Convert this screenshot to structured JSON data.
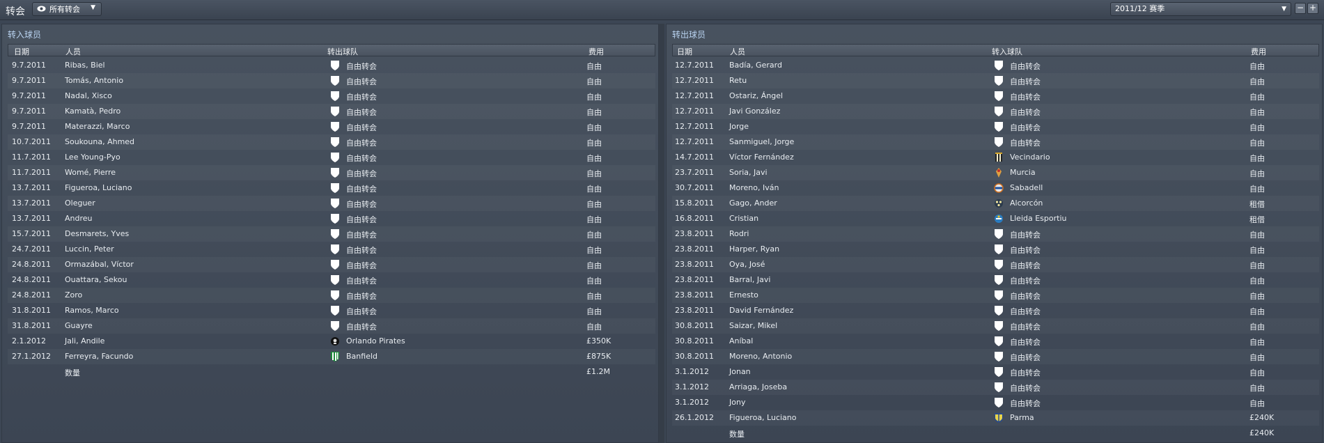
{
  "header": {
    "title": "转会",
    "view_label": "所有转会",
    "season_label": "2011/12 赛季"
  },
  "incoming": {
    "title": "转入球员",
    "columns": [
      "日期",
      "人员",
      "转出球队",
      "费用"
    ],
    "rows": [
      {
        "date": "9.7.2011",
        "person": "Ribas, Biel",
        "club": "自由转会",
        "fee": "自由",
        "crest": "shield"
      },
      {
        "date": "9.7.2011",
        "person": "Tomás, Antonio",
        "club": "自由转会",
        "fee": "自由",
        "crest": "shield"
      },
      {
        "date": "9.7.2011",
        "person": "Nadal, Xisco",
        "club": "自由转会",
        "fee": "自由",
        "crest": "shield"
      },
      {
        "date": "9.7.2011",
        "person": "Kamatà, Pedro",
        "club": "自由转会",
        "fee": "自由",
        "crest": "shield"
      },
      {
        "date": "9.7.2011",
        "person": "Materazzi, Marco",
        "club": "自由转会",
        "fee": "自由",
        "crest": "shield"
      },
      {
        "date": "10.7.2011",
        "person": "Soukouna, Ahmed",
        "club": "自由转会",
        "fee": "自由",
        "crest": "shield"
      },
      {
        "date": "11.7.2011",
        "person": "Lee Young-Pyo",
        "club": "自由转会",
        "fee": "自由",
        "crest": "shield"
      },
      {
        "date": "11.7.2011",
        "person": "Womé, Pierre",
        "club": "自由转会",
        "fee": "自由",
        "crest": "shield"
      },
      {
        "date": "13.7.2011",
        "person": "Figueroa, Luciano",
        "club": "自由转会",
        "fee": "自由",
        "crest": "shield"
      },
      {
        "date": "13.7.2011",
        "person": "Oleguer",
        "club": "自由转会",
        "fee": "自由",
        "crest": "shield"
      },
      {
        "date": "13.7.2011",
        "person": "Andreu",
        "club": "自由转会",
        "fee": "自由",
        "crest": "shield"
      },
      {
        "date": "15.7.2011",
        "person": "Desmarets, Yves",
        "club": "自由转会",
        "fee": "自由",
        "crest": "shield"
      },
      {
        "date": "24.7.2011",
        "person": "Luccin, Peter",
        "club": "自由转会",
        "fee": "自由",
        "crest": "shield"
      },
      {
        "date": "24.8.2011",
        "person": "Ormazábal, Víctor",
        "club": "自由转会",
        "fee": "自由",
        "crest": "shield"
      },
      {
        "date": "24.8.2011",
        "person": "Ouattara, Sekou",
        "club": "自由转会",
        "fee": "自由",
        "crest": "shield"
      },
      {
        "date": "24.8.2011",
        "person": "Zoro",
        "club": "自由转会",
        "fee": "自由",
        "crest": "shield"
      },
      {
        "date": "31.8.2011",
        "person": "Ramos, Marco",
        "club": "自由转会",
        "fee": "自由",
        "crest": "shield"
      },
      {
        "date": "31.8.2011",
        "person": "Guayre",
        "club": "自由转会",
        "fee": "自由",
        "crest": "shield"
      },
      {
        "date": "2.1.2012",
        "person": "Jali, Andile",
        "club": "Orlando Pirates",
        "fee": "£350K",
        "crest": "pirates"
      },
      {
        "date": "27.1.2012",
        "person": "Ferreyra, Facundo",
        "club": "Banfield",
        "fee": "£875K",
        "crest": "banfield"
      }
    ],
    "total_label": "数量",
    "total_fee": "£1.2M"
  },
  "outgoing": {
    "title": "转出球员",
    "columns": [
      "日期",
      "人员",
      "转入球队",
      "费用"
    ],
    "rows": [
      {
        "date": "12.7.2011",
        "person": "Badía, Gerard",
        "club": "自由转会",
        "fee": "自由",
        "crest": "shield"
      },
      {
        "date": "12.7.2011",
        "person": "Retu",
        "club": "自由转会",
        "fee": "自由",
        "crest": "shield"
      },
      {
        "date": "12.7.2011",
        "person": "Ostariz, Ángel",
        "club": "自由转会",
        "fee": "自由",
        "crest": "shield"
      },
      {
        "date": "12.7.2011",
        "person": "Javi González",
        "club": "自由转会",
        "fee": "自由",
        "crest": "shield"
      },
      {
        "date": "12.7.2011",
        "person": "Jorge",
        "club": "自由转会",
        "fee": "自由",
        "crest": "shield"
      },
      {
        "date": "12.7.2011",
        "person": "Sanmiguel, Jorge",
        "club": "自由转会",
        "fee": "自由",
        "crest": "shield"
      },
      {
        "date": "14.7.2011",
        "person": "Víctor Fernández",
        "club": "Vecindario",
        "fee": "自由",
        "crest": "vecindario"
      },
      {
        "date": "23.7.2011",
        "person": "Soria, Javi",
        "club": "Murcia",
        "fee": "自由",
        "crest": "murcia"
      },
      {
        "date": "30.7.2011",
        "person": "Moreno, Iván",
        "club": "Sabadell",
        "fee": "自由",
        "crest": "sabadell"
      },
      {
        "date": "15.8.2011",
        "person": "Gago, Ander",
        "club": "Alcorcón",
        "fee": "租借",
        "crest": "alcorcon"
      },
      {
        "date": "16.8.2011",
        "person": "Cristian",
        "club": "Lleida Esportiu",
        "fee": "租借",
        "crest": "lleida"
      },
      {
        "date": "23.8.2011",
        "person": "Rodri",
        "club": "自由转会",
        "fee": "自由",
        "crest": "shield"
      },
      {
        "date": "23.8.2011",
        "person": "Harper, Ryan",
        "club": "自由转会",
        "fee": "自由",
        "crest": "shield"
      },
      {
        "date": "23.8.2011",
        "person": "Oya, José",
        "club": "自由转会",
        "fee": "自由",
        "crest": "shield"
      },
      {
        "date": "23.8.2011",
        "person": "Barral, Javi",
        "club": "自由转会",
        "fee": "自由",
        "crest": "shield"
      },
      {
        "date": "23.8.2011",
        "person": "Ernesto",
        "club": "自由转会",
        "fee": "自由",
        "crest": "shield"
      },
      {
        "date": "23.8.2011",
        "person": "David Fernández",
        "club": "自由转会",
        "fee": "自由",
        "crest": "shield"
      },
      {
        "date": "30.8.2011",
        "person": "Saizar, Mikel",
        "club": "自由转会",
        "fee": "自由",
        "crest": "shield"
      },
      {
        "date": "30.8.2011",
        "person": "Aníbal",
        "club": "自由转会",
        "fee": "自由",
        "crest": "shield"
      },
      {
        "date": "30.8.2011",
        "person": "Moreno, Antonio",
        "club": "自由转会",
        "fee": "自由",
        "crest": "shield"
      },
      {
        "date": "3.1.2012",
        "person": "Jonan",
        "club": "自由转会",
        "fee": "自由",
        "crest": "shield"
      },
      {
        "date": "3.1.2012",
        "person": "Arriaga, Joseba",
        "club": "自由转会",
        "fee": "自由",
        "crest": "shield"
      },
      {
        "date": "3.1.2012",
        "person": "Jony",
        "club": "自由转会",
        "fee": "自由",
        "crest": "shield"
      },
      {
        "date": "26.1.2012",
        "person": "Figueroa, Luciano",
        "club": "Parma",
        "fee": "£240K",
        "crest": "parma"
      }
    ],
    "total_label": "数量",
    "total_fee": "£240K"
  }
}
